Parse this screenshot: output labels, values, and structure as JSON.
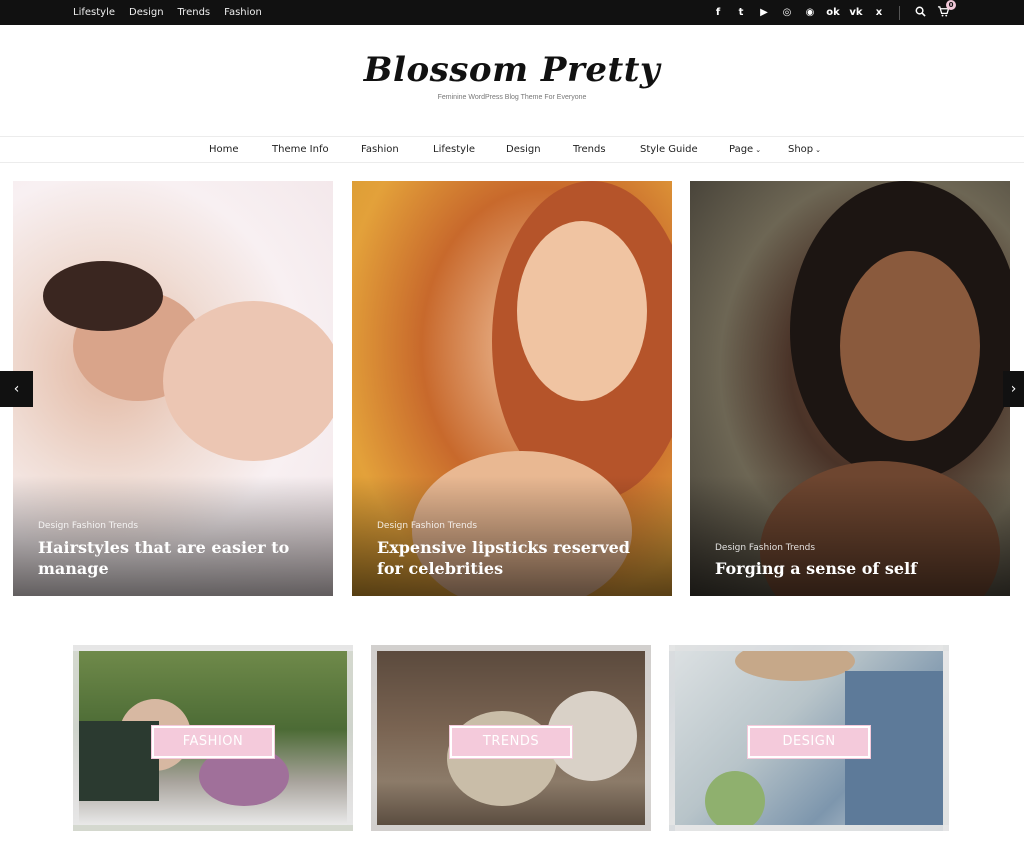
{
  "topbar": {
    "nav": [
      "Lifestyle",
      "Design",
      "Trends",
      "Fashion"
    ],
    "social_icons": [
      "facebook-icon",
      "twitter-icon",
      "youtube-icon",
      "instagram-icon",
      "dribbble-icon",
      "odnoklassniki-icon",
      "vk-icon",
      "xing-icon"
    ],
    "social_glyphs": {
      "facebook": "f",
      "twitter": "t",
      "youtube": "▶",
      "instagram": "◎",
      "dribbble": "◉",
      "odnoklassniki": "ok",
      "vk": "vk",
      "xing": "x"
    },
    "cart_count": "0"
  },
  "header": {
    "logo": "Blossom Pretty",
    "tagline": "Feminine WordPress Blog Theme For Everyone"
  },
  "mainnav": {
    "items": [
      "Home",
      "Theme Info",
      "Fashion",
      "Lifestyle",
      "Design",
      "Trends",
      "Style Guide",
      "Page",
      "Shop"
    ]
  },
  "slider": {
    "prev": "‹",
    "next": "›",
    "slides": [
      {
        "cats": "Design Fashion Trends",
        "title": "Hairstyles that are easier to manage"
      },
      {
        "cats": "Design Fashion Trends",
        "title": "Expensive lipsticks reserved for celebrities"
      },
      {
        "cats": "Design Fashion Trends",
        "title": "Forging a sense of self"
      }
    ]
  },
  "categories": [
    {
      "label": "FASHION"
    },
    {
      "label": "TRENDS"
    },
    {
      "label": "DESIGN"
    }
  ],
  "colors": {
    "topbar": "#111111",
    "accent_pink": "#f4cadb"
  }
}
